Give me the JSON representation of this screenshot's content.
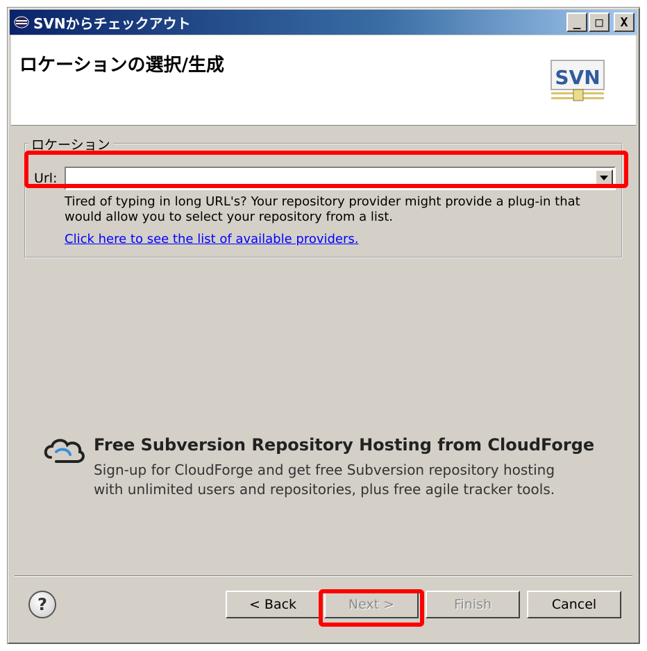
{
  "window": {
    "title": "SVNからチェックアウト",
    "min_label": "_",
    "max_label": "□",
    "close_label": "X"
  },
  "header": {
    "title": "ロケーションの選択/生成",
    "logo_text": "SVN"
  },
  "location_group": {
    "legend": "ロケーション",
    "url_label": "Url:",
    "url_value": "",
    "hint_line1": "Tired of typing in long URL's?  Your repository provider might provide a plug-in that",
    "hint_line2": "would allow you to select your repository from a list.",
    "provider_link": "Click here to see the list of available providers."
  },
  "promo": {
    "title": "Free Subversion Repository Hosting from CloudForge",
    "desc_line1": "Sign-up for CloudForge and get free Subversion repository hosting",
    "desc_line2": "with unlimited users and repositories, plus free agile tracker tools."
  },
  "buttons": {
    "help": "?",
    "back": "< Back",
    "next": "Next >",
    "finish": "Finish",
    "cancel": "Cancel"
  },
  "colors": {
    "highlight": "#ff0000",
    "link": "#0000ff",
    "titlebar": "#0a246a"
  }
}
